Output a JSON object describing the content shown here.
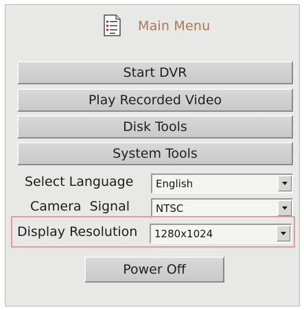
{
  "header": {
    "title": "Main Menu",
    "icon": "document-list-icon"
  },
  "menu_buttons": [
    {
      "label": "Start DVR"
    },
    {
      "label": "Play Recorded Video"
    },
    {
      "label": "Disk Tools"
    },
    {
      "label": "System Tools"
    }
  ],
  "settings": {
    "language": {
      "label": "Select Language",
      "value": "English"
    },
    "camera_signal": {
      "label": "Camera  Signal",
      "value": "NTSC"
    },
    "display_resolution": {
      "label": "Display Resolution",
      "value": "1280x1024",
      "highlighted": true
    }
  },
  "power_button": {
    "label": "Power Off"
  },
  "colors": {
    "panel_bg": "#e8e8e6",
    "title_text": "#a67a50",
    "highlight_border": "#e39aa0"
  }
}
